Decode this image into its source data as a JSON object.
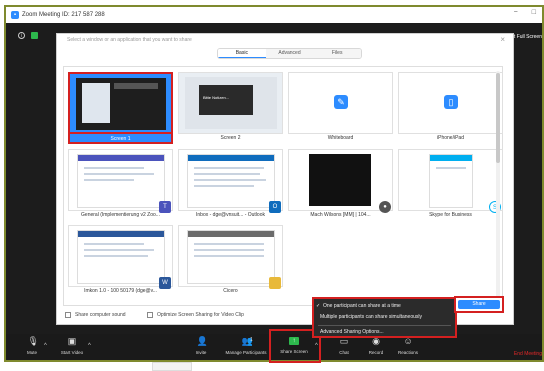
{
  "window": {
    "title": "Zoom Meeting ID: 217 587 288",
    "minimize": "−",
    "maximize": "□"
  },
  "meeting": {
    "exit_fullscreen": "Exit Full Screen"
  },
  "dialog": {
    "hint": "Select a window or an application that you want to share",
    "close": "×",
    "tabs": [
      {
        "label": "Basic"
      },
      {
        "label": "Advanced"
      },
      {
        "label": "Files"
      }
    ],
    "tiles": [
      {
        "label": "Screen 1"
      },
      {
        "label": "Screen 2",
        "preview_text": "Bitte Notizen..."
      },
      {
        "label": "Whiteboard"
      },
      {
        "label": "iPhone/iPad"
      },
      {
        "label": "General (Implementierung v2 Zoo...",
        "badge": "T"
      },
      {
        "label": "Inbox - dge@vnsuit... - Outlook",
        "badge": "O"
      },
      {
        "label": "Mach Wilsons [MM] | 104...",
        "badge": "●"
      },
      {
        "label": "Skype for Business",
        "badge": "S"
      },
      {
        "label": "Imkon 1.0 - 100 50179 (dge@v...",
        "badge": "W"
      },
      {
        "label": "Cicero"
      }
    ],
    "footer": {
      "share_sound": "Share computer sound",
      "optimize": "Optimize Screen Sharing for Video Clip"
    },
    "share_button": "Share"
  },
  "share_menu": {
    "check": "✓",
    "option_one": "One participant can share at a time",
    "option_multi": "Multiple participants can share simultaneously",
    "advanced": "Advanced Sharing Options..."
  },
  "toolbar": {
    "mute": "Mute",
    "start_video": "Start Video",
    "invite": "Invite",
    "manage_participants": "Manage Participants",
    "participants_count": "1",
    "share_screen": "Share Screen",
    "chat": "Chat",
    "record": "Record",
    "reactions": "Reactions",
    "end_meeting": "End Meeting"
  },
  "colors": {
    "accent": "#2d8cff",
    "highlight": "#d42020",
    "green": "#2db84d",
    "frame": "#7f8a2e"
  }
}
